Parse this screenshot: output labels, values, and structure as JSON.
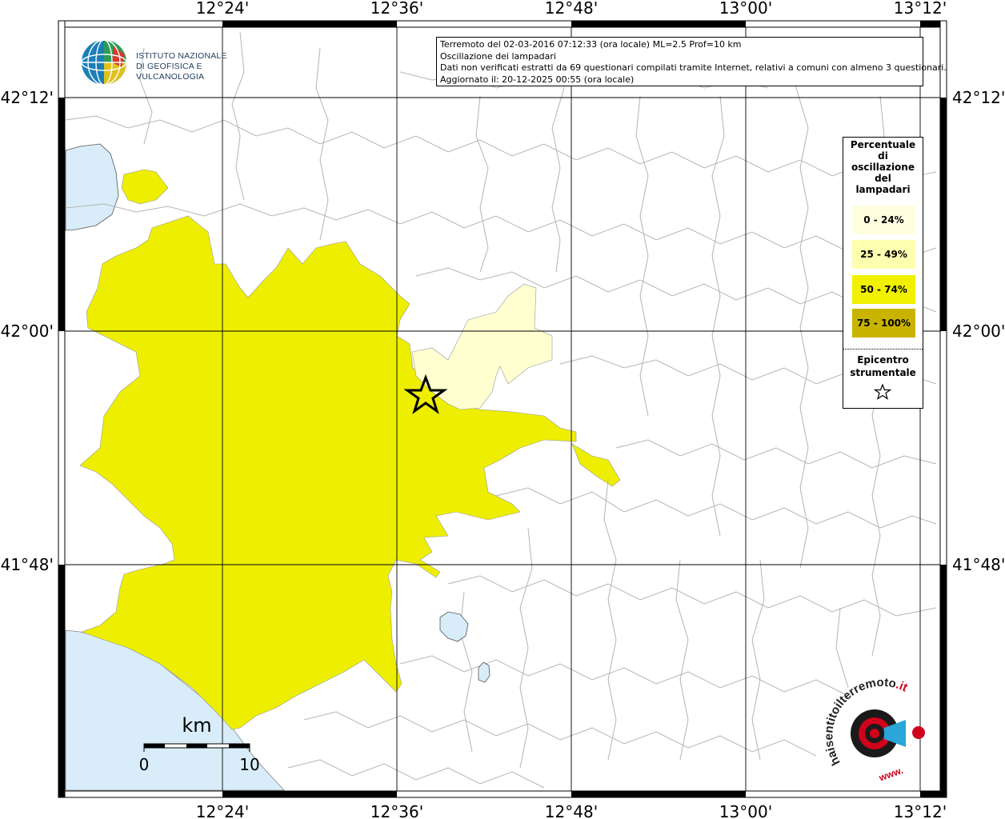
{
  "header": {
    "line1": "Terremoto del 02-03-2016 07:12:33 (ora locale) ML=2.5 Prof=10 km",
    "line2": "Oscillazione dei lampadari",
    "line3": "Dati non verificati estratti da 69 questionari compilati tramite Internet, relativi a comuni con almeno 3 questionari.",
    "line4": "Aggiornato il: 20-12-2025 00:55 (ora locale)"
  },
  "logo": {
    "line1": "ISTITUTO NAZIONALE",
    "line2": "DI GEOFISICA E VULCANOLOGIA"
  },
  "axes": {
    "lon_ticks": [
      "12°24'",
      "12°36'",
      "12°48'",
      "13°00'",
      "13°12'"
    ],
    "lat_ticks": [
      "42°12'",
      "42°00'",
      "41°48'"
    ]
  },
  "legend": {
    "title": [
      "Percentuale",
      "di",
      "oscillazione",
      "del",
      "lampadari"
    ],
    "classes": [
      {
        "label": "0 - 24%",
        "color": "#ffffe0"
      },
      {
        "label": "25 - 49%",
        "color": "#ffffb0"
      },
      {
        "label": "50 - 74%",
        "color": "#f0f000"
      },
      {
        "label": "75 - 100%",
        "color": "#c8b400"
      }
    ],
    "epicenter": [
      "Epicentro",
      "strumentale"
    ]
  },
  "scale": {
    "unit": "km",
    "start": "0",
    "end": "10"
  },
  "watermark": {
    "text_main": "haisentitoilterremoto",
    "text_tld": ".it",
    "text_www": "www."
  },
  "colors": {
    "sea": "#d8edf9",
    "zone_50_74": "#eeee00",
    "zone_0_24": "#ffffd0",
    "border": "#b4b4b4",
    "grid": "#000000"
  }
}
